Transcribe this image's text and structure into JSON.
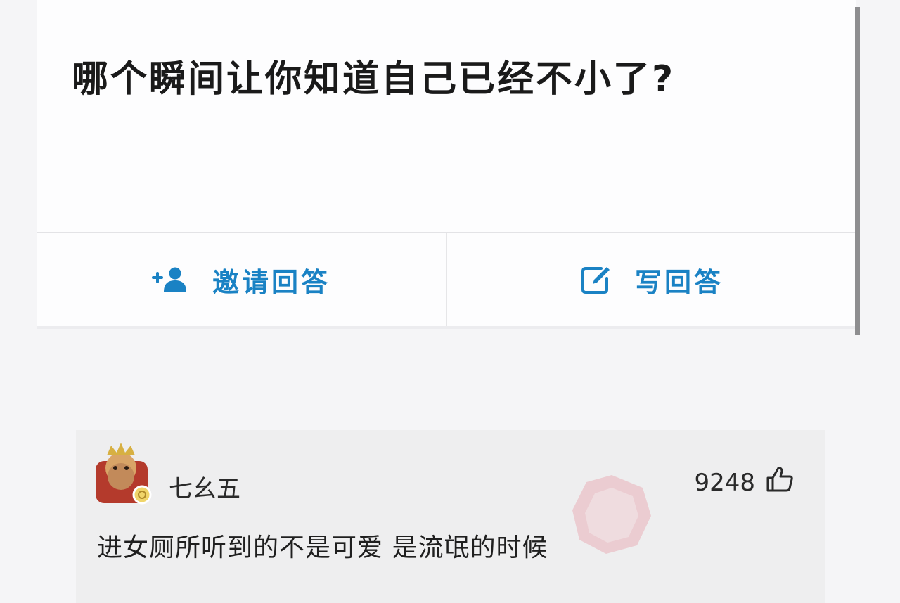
{
  "question": {
    "title": "哪个瞬间让你知道自己已经不小了?"
  },
  "actions": {
    "invite_label": "邀请回答",
    "write_label": "写回答",
    "invite_icon": "add-user-icon",
    "write_icon": "edit-icon"
  },
  "answer": {
    "username": "七幺五",
    "likes": "9248",
    "like_icon": "thumbs-up-icon",
    "text": "进女厕所听到的不是可爱 是流氓的时候"
  },
  "colors": {
    "accent": "#1a82c4",
    "background": "#f5f5f7",
    "card": "#fdfdfe",
    "answer_card": "#eeeeef"
  }
}
